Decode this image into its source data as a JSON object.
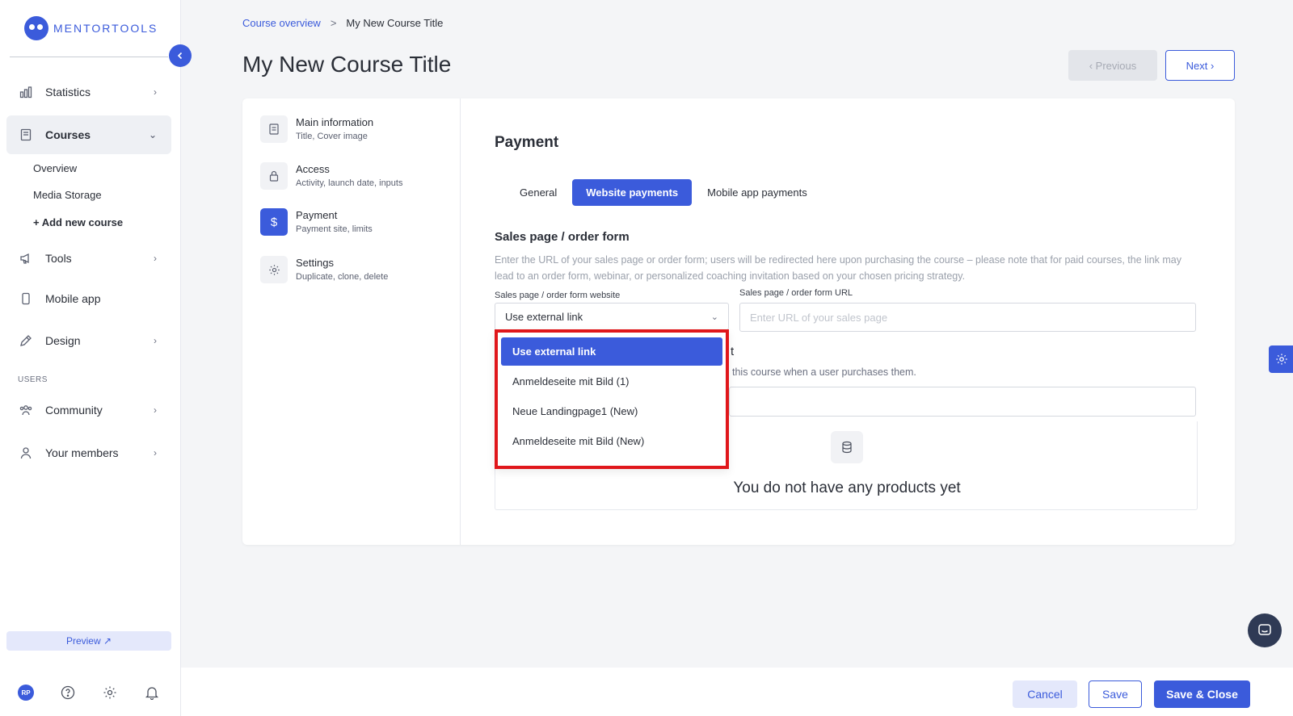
{
  "brand": {
    "name": "MENTORTOOLS",
    "accent": "#3b5bdb"
  },
  "sidebar": {
    "items": [
      {
        "label": "Statistics",
        "icon": "bar-chart-icon"
      },
      {
        "label": "Courses",
        "icon": "book-icon"
      },
      {
        "label": "Tools",
        "icon": "megaphone-icon"
      },
      {
        "label": "Mobile app",
        "icon": "mobile-icon"
      },
      {
        "label": "Design",
        "icon": "pen-icon"
      },
      {
        "label": "Community",
        "icon": "users-icon"
      },
      {
        "label": "Your members",
        "icon": "user-icon"
      }
    ],
    "sub_items": [
      "Overview",
      "Media Storage",
      "+ Add new course"
    ],
    "section_users": "USERS",
    "preview_label": "Preview ↗",
    "avatar_initials": "RP"
  },
  "breadcrumb": {
    "parent": "Course overview",
    "separator": ">",
    "current": "My New Course Title"
  },
  "page_title": "My New Course Title",
  "nav_buttons": {
    "previous": "‹  Previous",
    "next": "Next  ›"
  },
  "steps": [
    {
      "title": "Main information",
      "subtitle": "Title, Cover image"
    },
    {
      "title": "Access",
      "subtitle": "Activity, launch date, inputs"
    },
    {
      "title": "Payment",
      "subtitle": "Payment site, limits"
    },
    {
      "title": "Settings",
      "subtitle": "Duplicate, clone, delete"
    }
  ],
  "payment": {
    "title": "Payment",
    "tabs": [
      "General",
      "Website payments",
      "Mobile app payments"
    ],
    "sales_title": "Sales page / order form",
    "sales_desc": "Enter the URL of your sales page or order form; users will be redirected here upon purchasing the course – please note that for paid courses, the link may lead to an order form, webinar, or personalized coaching invitation based on your chosen pricing strategy.",
    "website_label": "Sales page / order form website",
    "url_label": "Sales page / order form URL",
    "select_value": "Use external link",
    "url_placeholder": "Enter URL of your sales page",
    "products_title_fragment": "t",
    "products_desc_fragment": "this course when a user purchases them.",
    "empty_text": "You do not have any products yet"
  },
  "dropdown": {
    "options": [
      "Use external link",
      "Anmeldeseite mit Bild (1)",
      "Neue Landingpage1 (New)",
      "Anmeldeseite mit Bild (New)"
    ]
  },
  "footer": {
    "cancel": "Cancel",
    "save": "Save",
    "save_close": "Save & Close"
  }
}
